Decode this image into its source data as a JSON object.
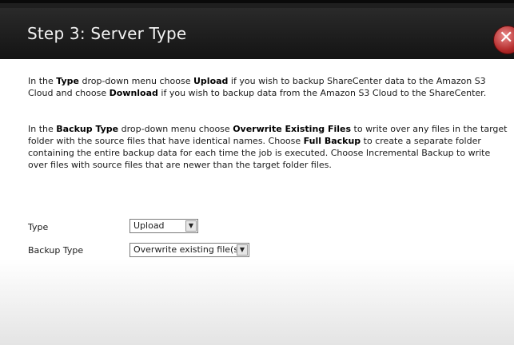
{
  "dialog": {
    "title": "Step 3: Server Type",
    "close_glyph": "✕"
  },
  "paragraphs": {
    "p1": [
      {
        "t": "In the ",
        "b": false
      },
      {
        "t": "Type",
        "b": true
      },
      {
        "t": " drop-down menu choose ",
        "b": false
      },
      {
        "t": "Upload",
        "b": true
      },
      {
        "t": " if you wish to backup ShareCenter data to the Amazon S3 Cloud and choose ",
        "b": false
      },
      {
        "t": "Download",
        "b": true
      },
      {
        "t": " if you wish to backup data from the Amazon S3 Cloud to the ShareCenter.",
        "b": false
      }
    ],
    "p2": [
      {
        "t": "In the ",
        "b": false
      },
      {
        "t": "Backup Type",
        "b": true
      },
      {
        "t": " drop-down menu choose ",
        "b": false
      },
      {
        "t": "Overwrite Existing Files",
        "b": true
      },
      {
        "t": " to write over any files in the target folder with the source files that have identical names. Choose ",
        "b": false
      },
      {
        "t": "Full Backup",
        "b": true
      },
      {
        "t": " to create a separate folder containing the entire backup data for each time the job is executed. Choose Incremental Backup to write over files with source files that are newer than the target folder files.",
        "b": false
      }
    ]
  },
  "form": {
    "type_label": "Type",
    "type_value": "Upload",
    "backup_type_label": "Backup Type",
    "backup_type_value": "Overwrite existing file(s)"
  },
  "icons": {
    "close": "close-icon",
    "dropdown": "chevron-down-icon"
  },
  "colors": {
    "titlebar": "#1f1f1f",
    "close_button": "#b42b2b"
  }
}
